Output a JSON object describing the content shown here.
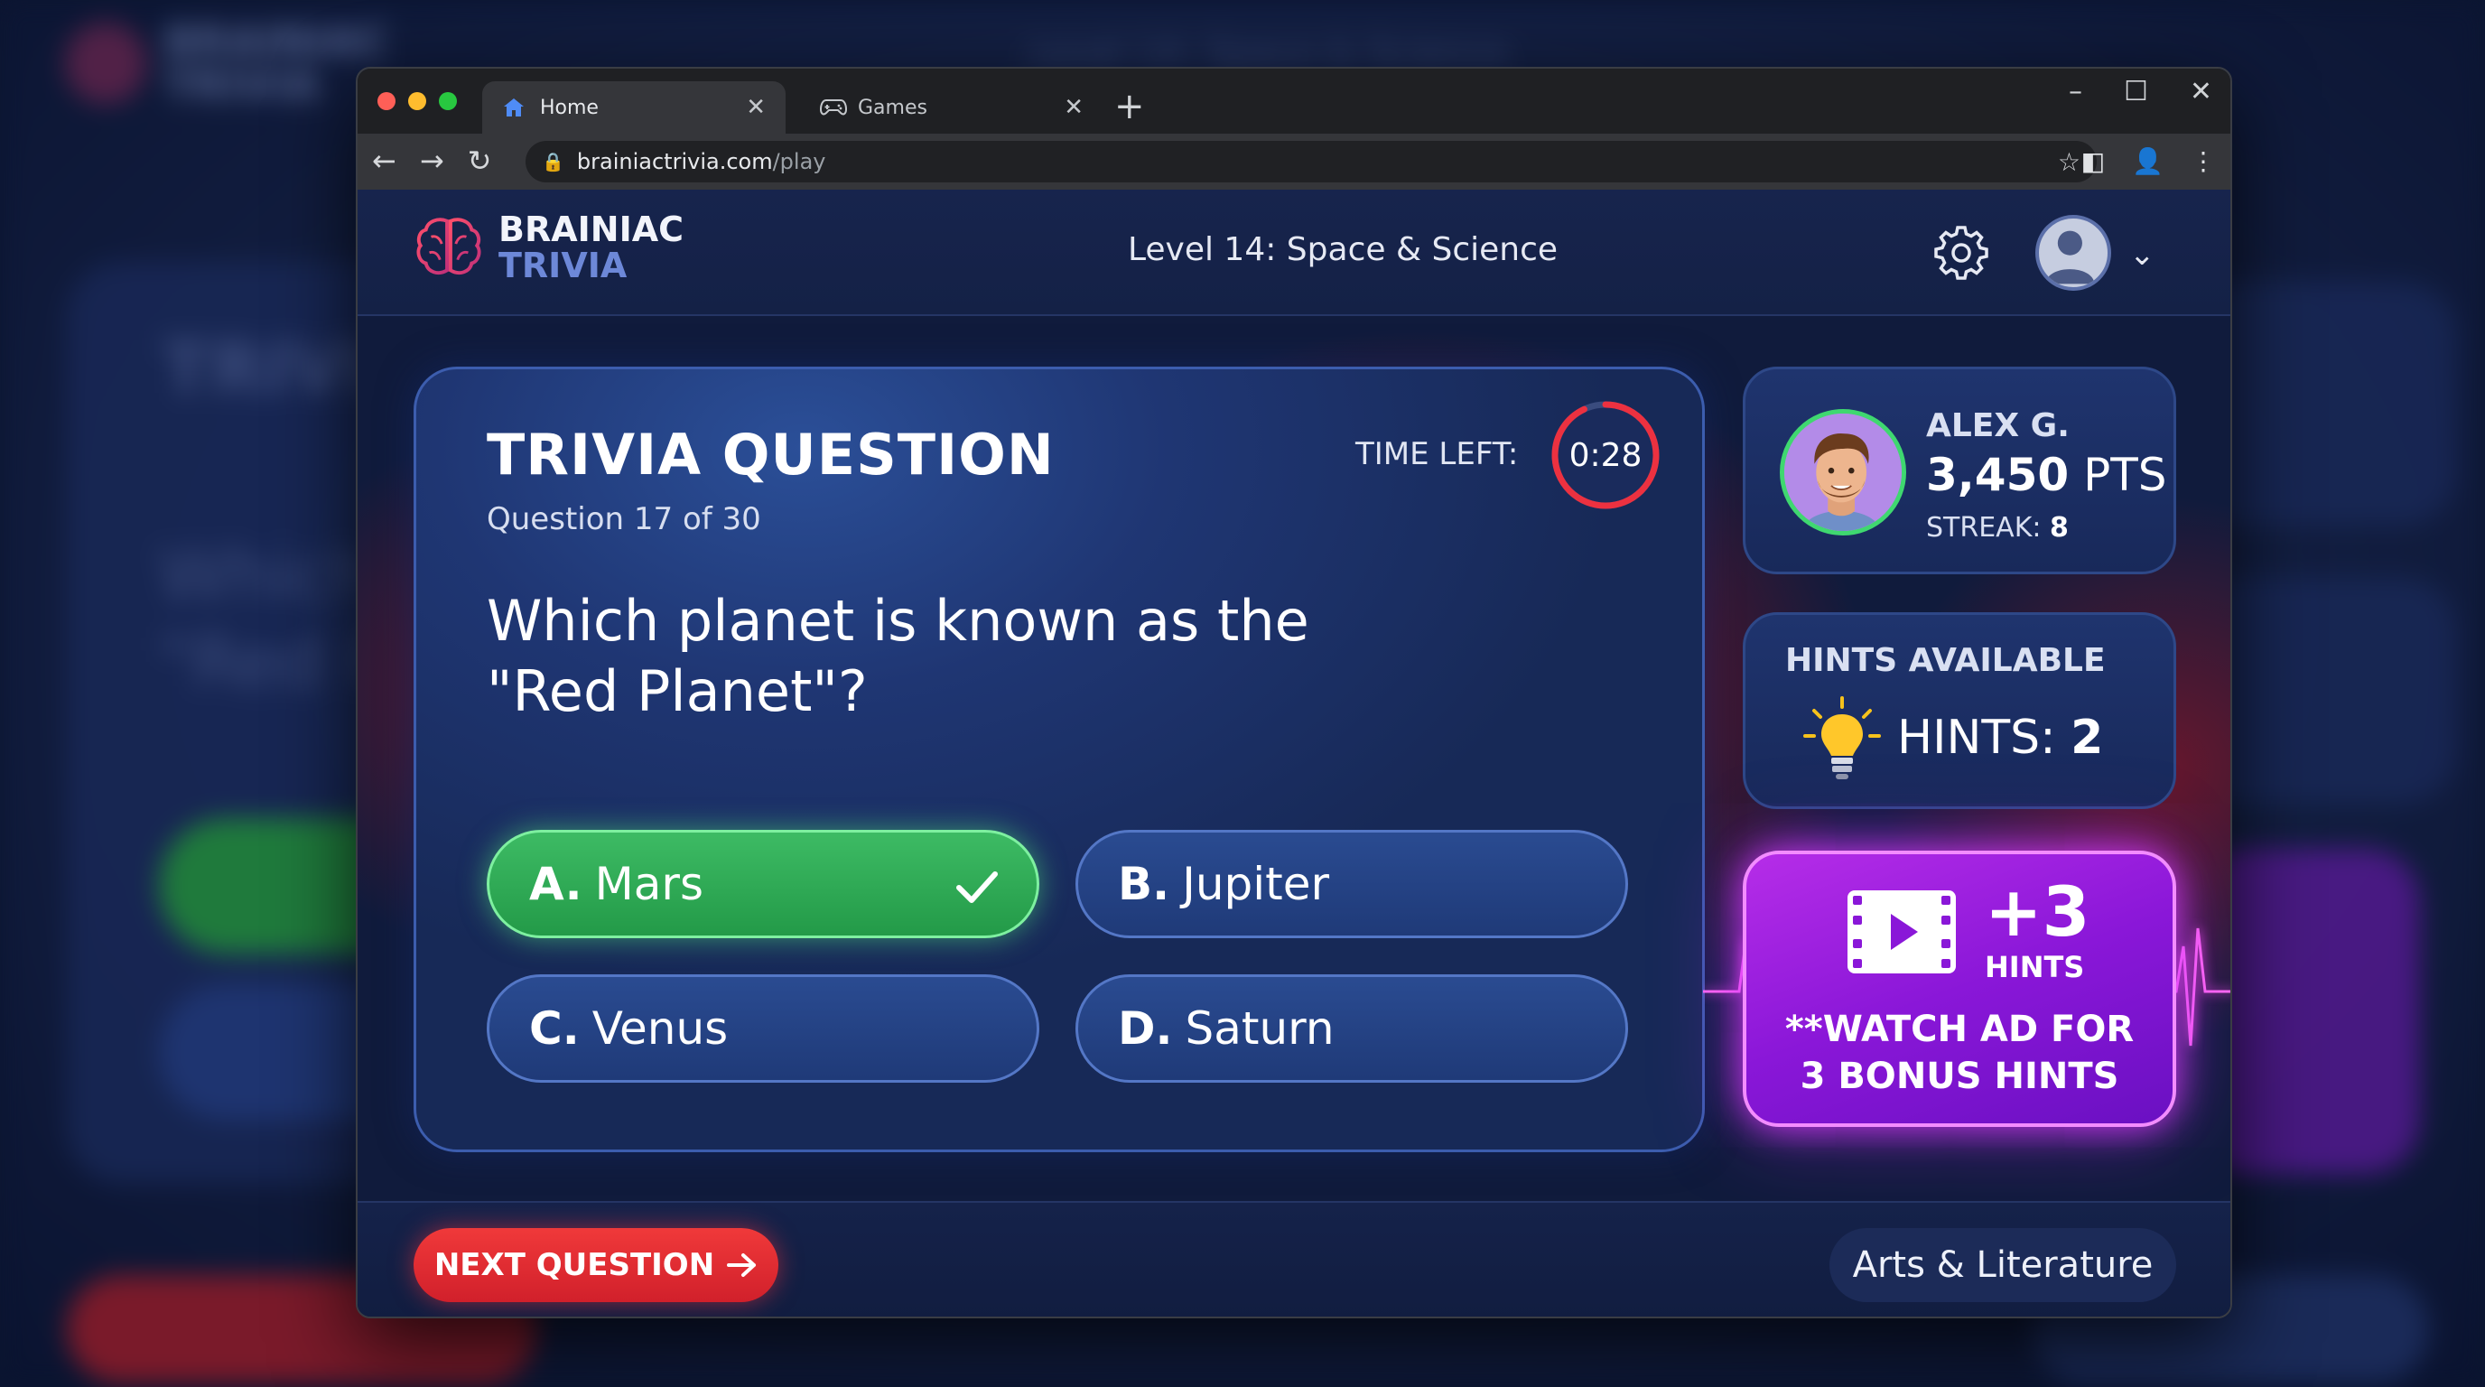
{
  "browser": {
    "tabs": [
      {
        "label": "Home",
        "icon": "home-icon",
        "active": true
      },
      {
        "label": "Games",
        "icon": "gamepad-icon",
        "active": false
      }
    ],
    "url_host": "brainiactrivia.com",
    "url_path": "/play"
  },
  "header": {
    "logo_line1": "BRAINIAC",
    "logo_line2": "TRIVIA",
    "level_title": "Level 14: Space & Science"
  },
  "question": {
    "title": "TRIVIA QUESTION",
    "progress_text": "Question 17 of 30",
    "current": 17,
    "total": 30,
    "time_label": "TIME LEFT:",
    "time_value": "0:28",
    "timer_fraction_remaining": 0.93,
    "text": "Which planet is known as the \"Red Planet\"?",
    "answers": [
      {
        "letter": "A.",
        "text": "Mars",
        "correct": true
      },
      {
        "letter": "B.",
        "text": "Jupiter",
        "correct": false
      },
      {
        "letter": "C.",
        "text": "Venus",
        "correct": false
      },
      {
        "letter": "D.",
        "text": "Saturn",
        "correct": false
      }
    ]
  },
  "player": {
    "name": "ALEX G.",
    "points_value": "3,450",
    "points_unit": "PTS",
    "streak_label": "STREAK:",
    "streak_value": "8"
  },
  "hints": {
    "title": "HINTS AVAILABLE",
    "count_label": "HINTS:",
    "count_value": "2"
  },
  "ad": {
    "bonus": "+3",
    "bonus_unit": "HINTS",
    "text_line1": "**WATCH AD FOR",
    "text_line2": "3 BONUS HINTS"
  },
  "footer": {
    "next_label": "NEXT QUESTION",
    "category": "Arts & Literature"
  },
  "colors": {
    "correct": "#2fae57",
    "accent_red": "#e0283a",
    "ad_purple": "#9a1fe0",
    "card_blue": "#1f3673"
  }
}
